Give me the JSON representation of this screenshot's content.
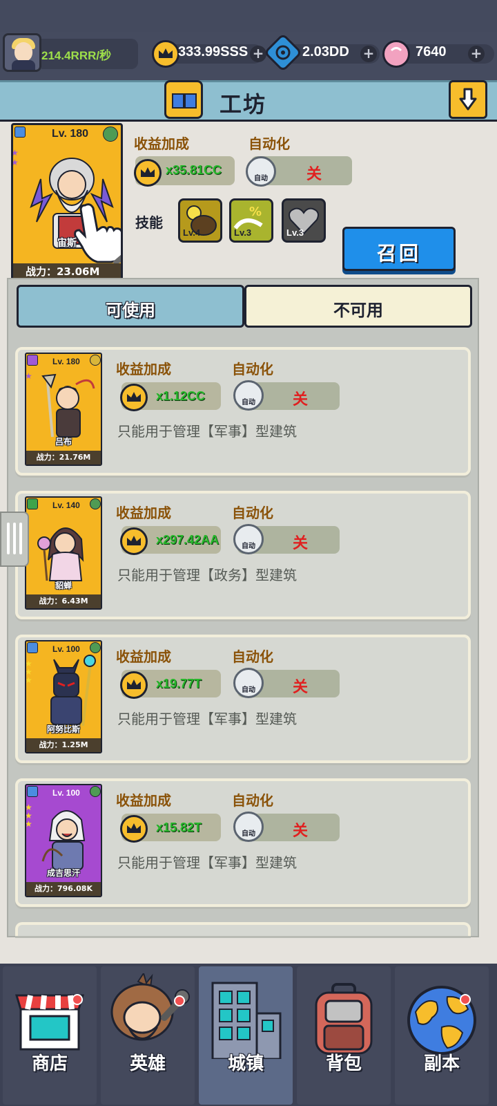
{
  "colors": {
    "accent_gold": "#f7bd2c",
    "header_blue": "#8ebfd0",
    "recall_blue": "#1f8fea",
    "green_value": "#28b82c",
    "off_red": "#e02020"
  },
  "topbar": {
    "income_rate": "214.4RRR/秒",
    "gold": "333.99SSS",
    "gems": "2.03DD",
    "candy": "7640"
  },
  "header": {
    "title": "工坊"
  },
  "selected": {
    "level": "Lv. 180",
    "name": "宙斯",
    "power": "战力：23.06M",
    "bonus_label": "收益加成",
    "bonus_value": "x35.81CC",
    "auto_label": "自动化",
    "auto_icon_text": "自动",
    "auto_state": "关",
    "skills_label": "技能",
    "skills": [
      {
        "level": "Lv.4"
      },
      {
        "level": "Lv.3"
      },
      {
        "level": "Lv.3"
      }
    ],
    "recall_button": "召回"
  },
  "tabs": [
    {
      "label": "可使用"
    },
    {
      "label": "不可用"
    }
  ],
  "heroes": [
    {
      "level": "Lv. 180",
      "name": "吕布",
      "power": "战力：21.76M",
      "bonus_label": "收益加成",
      "bonus_value": "x1.12CC",
      "auto_label": "自动化",
      "auto_icon_text": "自动",
      "auto_state": "关",
      "desc": "只能用于管理【军事】型建筑"
    },
    {
      "level": "Lv. 140",
      "name": "貂蝉",
      "power": "战力：6.43M",
      "bonus_label": "收益加成",
      "bonus_value": "x297.42AA",
      "auto_label": "自动化",
      "auto_icon_text": "自动",
      "auto_state": "关",
      "desc": "只能用于管理【政务】型建筑"
    },
    {
      "level": "Lv. 100",
      "name": "阿努比斯",
      "power": "战力：1.25M",
      "bonus_label": "收益加成",
      "bonus_value": "x19.77T",
      "auto_label": "自动化",
      "auto_icon_text": "自动",
      "auto_state": "关",
      "desc": "只能用于管理【军事】型建筑"
    },
    {
      "level": "Lv. 100",
      "name": "成吉思汗",
      "power": "战力：796.08K",
      "bonus_label": "收益加成",
      "bonus_value": "x15.82T",
      "auto_label": "自动化",
      "auto_icon_text": "自动",
      "auto_state": "关",
      "desc": "只能用于管理【军事】型建筑"
    }
  ],
  "nav": [
    {
      "label": "商店",
      "icon": "shop-icon"
    },
    {
      "label": "英雄",
      "icon": "hero-icon"
    },
    {
      "label": "城镇",
      "icon": "town-icon"
    },
    {
      "label": "背包",
      "icon": "backpack-icon"
    },
    {
      "label": "副本",
      "icon": "globe-icon"
    }
  ]
}
